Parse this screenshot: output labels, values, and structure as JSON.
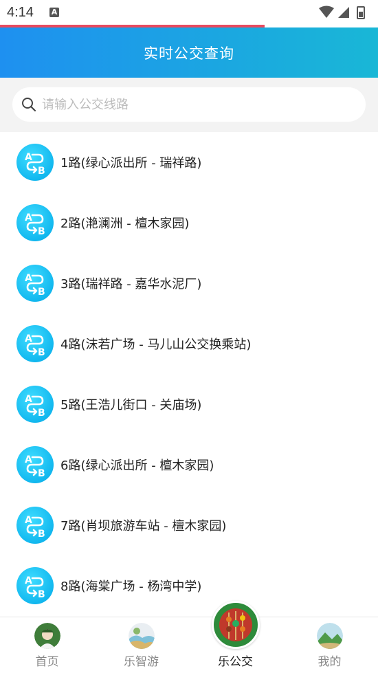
{
  "status_bar": {
    "time": "4:14",
    "notification_letter": "A"
  },
  "header": {
    "title": "实时公交查询"
  },
  "search": {
    "placeholder": "请输入公交线路",
    "value": ""
  },
  "routes": [
    {
      "label": "1路(绿心派出所 - 瑞祥路)"
    },
    {
      "label": "2路(滟澜洲 - 檀木家园)"
    },
    {
      "label": "3路(瑞祥路 - 嘉华水泥厂)"
    },
    {
      "label": "4路(沫若广场 - 马儿山公交换乘站)"
    },
    {
      "label": "5路(王浩儿街口 - 关庙场)"
    },
    {
      "label": "6路(绿心派出所 - 檀木家园)"
    },
    {
      "label": "7路(肖坝旅游车站 - 檀木家园)"
    },
    {
      "label": "8路(海棠广场 - 杨湾中学)"
    }
  ],
  "tabs": [
    {
      "label": "首页",
      "icon": "person-avatar-icon",
      "active": false
    },
    {
      "label": "乐智游",
      "icon": "landscape-icon",
      "active": false
    },
    {
      "label": "乐公交",
      "icon": "skewer-food-icon",
      "active": true
    },
    {
      "label": "我的",
      "icon": "mountain-landscape-icon",
      "active": false
    }
  ],
  "colors": {
    "header_start": "#1e90f0",
    "header_end": "#19b7d6",
    "route_icon": "#12b8ef",
    "progress": "#e84a5f"
  }
}
